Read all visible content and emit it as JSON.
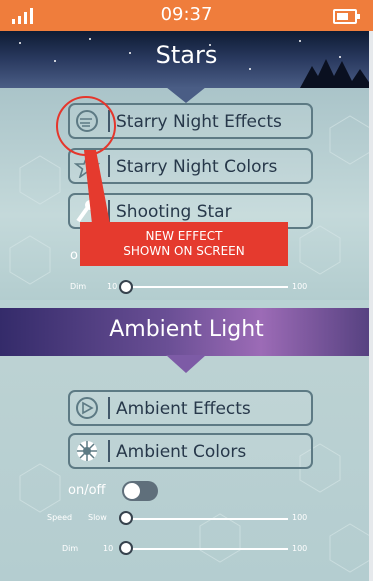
{
  "status_bar": {
    "time": "09:37",
    "signal_icon": "signal-bars-icon",
    "battery_icon": "battery-icon",
    "color": "#ef7d3c"
  },
  "stars": {
    "title": "Stars",
    "options": [
      {
        "label": "Starry Night Effects",
        "icon": "wind-fan-icon"
      },
      {
        "label": "Starry Night Colors",
        "icon": "star-outline-icon"
      },
      {
        "label": "Shooting Star",
        "icon": "shooting-star-icon"
      }
    ],
    "callout": {
      "line1": "NEW EFFECT",
      "line2": "SHOWN ON SCREEN"
    },
    "partial_label": "o",
    "dim_slider": {
      "label": "Dim",
      "min": "10",
      "max": "100",
      "value_fraction": 0.0
    }
  },
  "ambient": {
    "title": "Ambient Light",
    "options": [
      {
        "label": "Ambient Effects",
        "icon": "play-triangle-icon"
      },
      {
        "label": "Ambient Colors",
        "icon": "color-wheel-icon"
      }
    ],
    "toggle": {
      "label": "on/off",
      "on": false
    },
    "speed_slider": {
      "label": "Speed",
      "min": "Slow",
      "max": "100",
      "value_fraction": 0.0
    },
    "dim_slider": {
      "label": "Dim",
      "min": "10",
      "max": "100",
      "value_fraction": 0.0
    }
  }
}
